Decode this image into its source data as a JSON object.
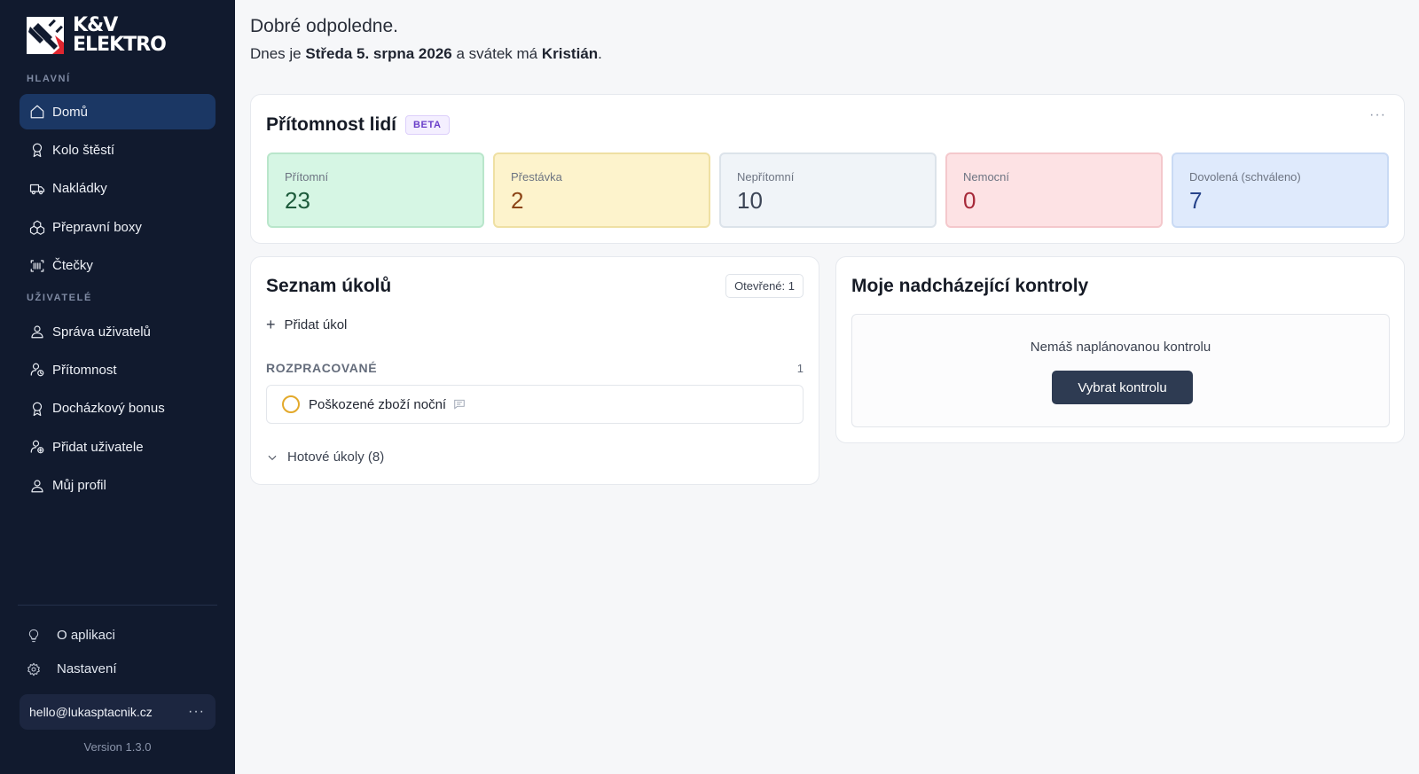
{
  "brand": {
    "line1": "K&V",
    "line2": "ELEKTRO"
  },
  "sidebar": {
    "sections": [
      {
        "label": "HLAVNÍ"
      },
      {
        "label": "UŽIVATELÉ"
      }
    ],
    "main_items": [
      {
        "label": "Domů",
        "icon": "home-icon",
        "active": true
      },
      {
        "label": "Kolo štěstí",
        "icon": "award-icon"
      },
      {
        "label": "Nakládky",
        "icon": "truck-icon"
      },
      {
        "label": "Přepravní boxy",
        "icon": "boxes-icon"
      },
      {
        "label": "Čtečky",
        "icon": "barcode-scanner-icon"
      }
    ],
    "user_items": [
      {
        "label": "Správa uživatelů",
        "icon": "user-icon"
      },
      {
        "label": "Přítomnost",
        "icon": "user-clock-icon"
      },
      {
        "label": "Docházkový bonus",
        "icon": "award-icon"
      },
      {
        "label": "Přidat uživatele",
        "icon": "user-plus-icon"
      },
      {
        "label": "Můj profil",
        "icon": "user-icon"
      }
    ],
    "bottom_items": [
      {
        "label": "O aplikaci",
        "icon": "lightbulb-icon"
      },
      {
        "label": "Nastavení",
        "icon": "gear-icon"
      }
    ],
    "user_email": "hello@lukasptacnik.cz",
    "more": "···",
    "version": "Version 1.3.0"
  },
  "header": {
    "greeting": "Dobré odpoledne.",
    "date_prefix": "Dnes je ",
    "date": "Středa 5. srpna 2026",
    "name_day_prefix": " a svátek má ",
    "name_day": "Kristián",
    "suffix": "."
  },
  "attendance": {
    "title": "Přítomnost lidí",
    "badge": "BETA",
    "more": "···",
    "stats": [
      {
        "label": "Přítomní",
        "value": "23",
        "color": "#d6f6e4"
      },
      {
        "label": "Přestávka",
        "value": "2",
        "color": "#fdf3cc"
      },
      {
        "label": "Nepřítomní",
        "value": "10",
        "color": "#f0f4f8"
      },
      {
        "label": "Nemocní",
        "value": "0",
        "color": "#fde2e4"
      },
      {
        "label": "Dovolená (schváleno)",
        "value": "7",
        "color": "#dfeafc"
      }
    ]
  },
  "tasks": {
    "title": "Seznam úkolů",
    "open_badge": "Otevřené: 1",
    "add_label": "Přidat úkol",
    "group_label": "ROZPRACOVANÉ",
    "group_count": "1",
    "items": [
      {
        "label": "Poškozené zboží noční"
      }
    ],
    "done_label": "Hotové úkoly (8)"
  },
  "controls": {
    "title": "Moje nadcházející kontroly",
    "empty_text": "Nemáš naplánovanou kontrolu",
    "button_label": "Vybrat kontrolu"
  },
  "colors": {
    "sidebar_bg": "#111a2e",
    "active_item": "#1b3764",
    "primary_button": "#2e3b52",
    "beta_accent": "#6a3fc9"
  }
}
